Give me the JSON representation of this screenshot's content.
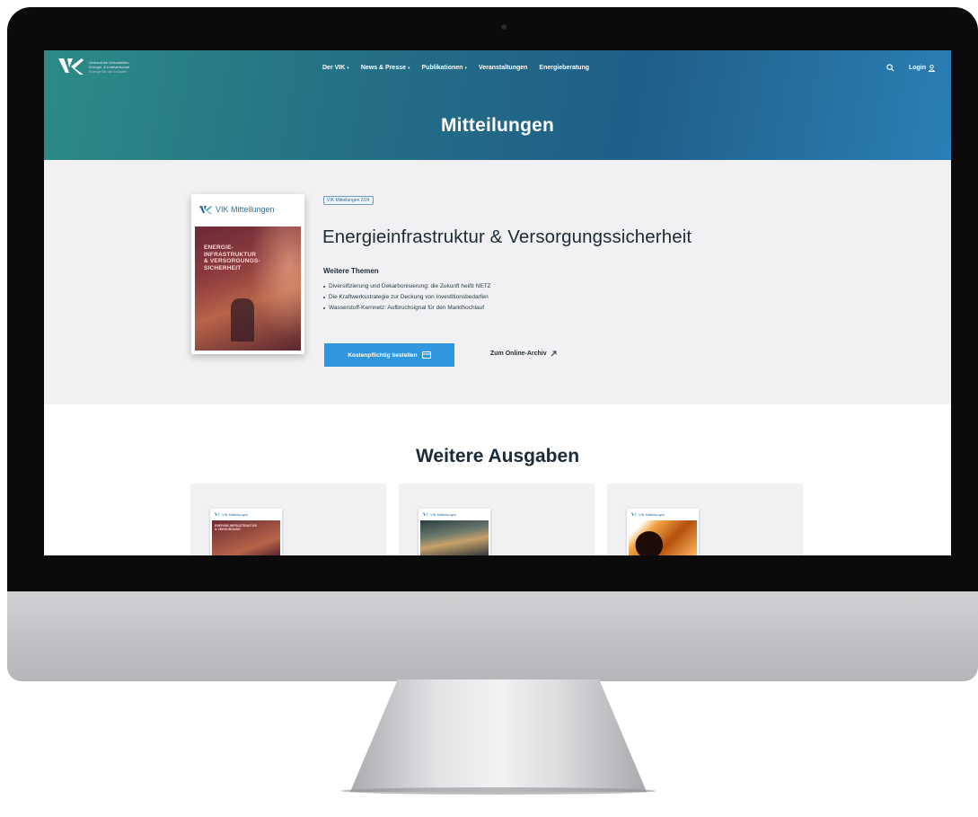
{
  "logo": {
    "line1": "Verband der Industriellen",
    "line2": "Energie- & Kraftwirtschaft",
    "line3": "Energie für die Industrie"
  },
  "nav": {
    "items": [
      {
        "label": "Der VIK",
        "has_dropdown": true
      },
      {
        "label": "News & Presse",
        "has_dropdown": true
      },
      {
        "label": "Publikationen",
        "has_dropdown": true
      },
      {
        "label": "Veranstaltungen",
        "has_dropdown": false
      },
      {
        "label": "Energieberatung",
        "has_dropdown": false
      }
    ],
    "caret": "▾",
    "login_label": "Login",
    "icons": {
      "search": "search-icon",
      "user": "user-icon"
    }
  },
  "hero": {
    "title": "Mitteilungen"
  },
  "featured": {
    "cover": {
      "brand": "VIK Mitteilungen",
      "headline_lines": [
        "ENERGIE-",
        "INFRASTRUKTUR",
        "& VERSORGUNGS-",
        "SICHERHEIT"
      ]
    },
    "badge": "VIK Mitteilungen 2/24",
    "title": "Energieinfrastruktur & Versorgungssicherheit",
    "themes_label": "Weitere Themen",
    "topics": [
      "Diversifizierung und Dekarbonisierung: die Zukunft heißt NETZ",
      "Die Kraftwerksstrategie zur Deckung von Investitionsbedarfen",
      "Wasserstoff-Kernnetz: Aufbruchsignal für den Markthochlauf"
    ],
    "order_button": "Kostenpflichtig bestellen",
    "archive_link": "Zum Online-Archiv"
  },
  "more": {
    "title": "Weitere Ausgaben",
    "cards": [
      {
        "brand": "VIK Mitteilungen",
        "cover_text": "ENERGIE-INFRASTRUKTUR & VERSORGUNG"
      },
      {
        "brand": "VIK Mitteilungen",
        "cover_text": ""
      },
      {
        "brand": "VIK Mitteilungen",
        "cover_text": ""
      }
    ]
  },
  "colors": {
    "hero_gradient": [
      "#2d8b86",
      "#1f5f88",
      "#2b7fb6"
    ],
    "accent_button": "#2f97dd",
    "text_dark": "#1c2b36",
    "section_bg": "#f1f1f3"
  }
}
